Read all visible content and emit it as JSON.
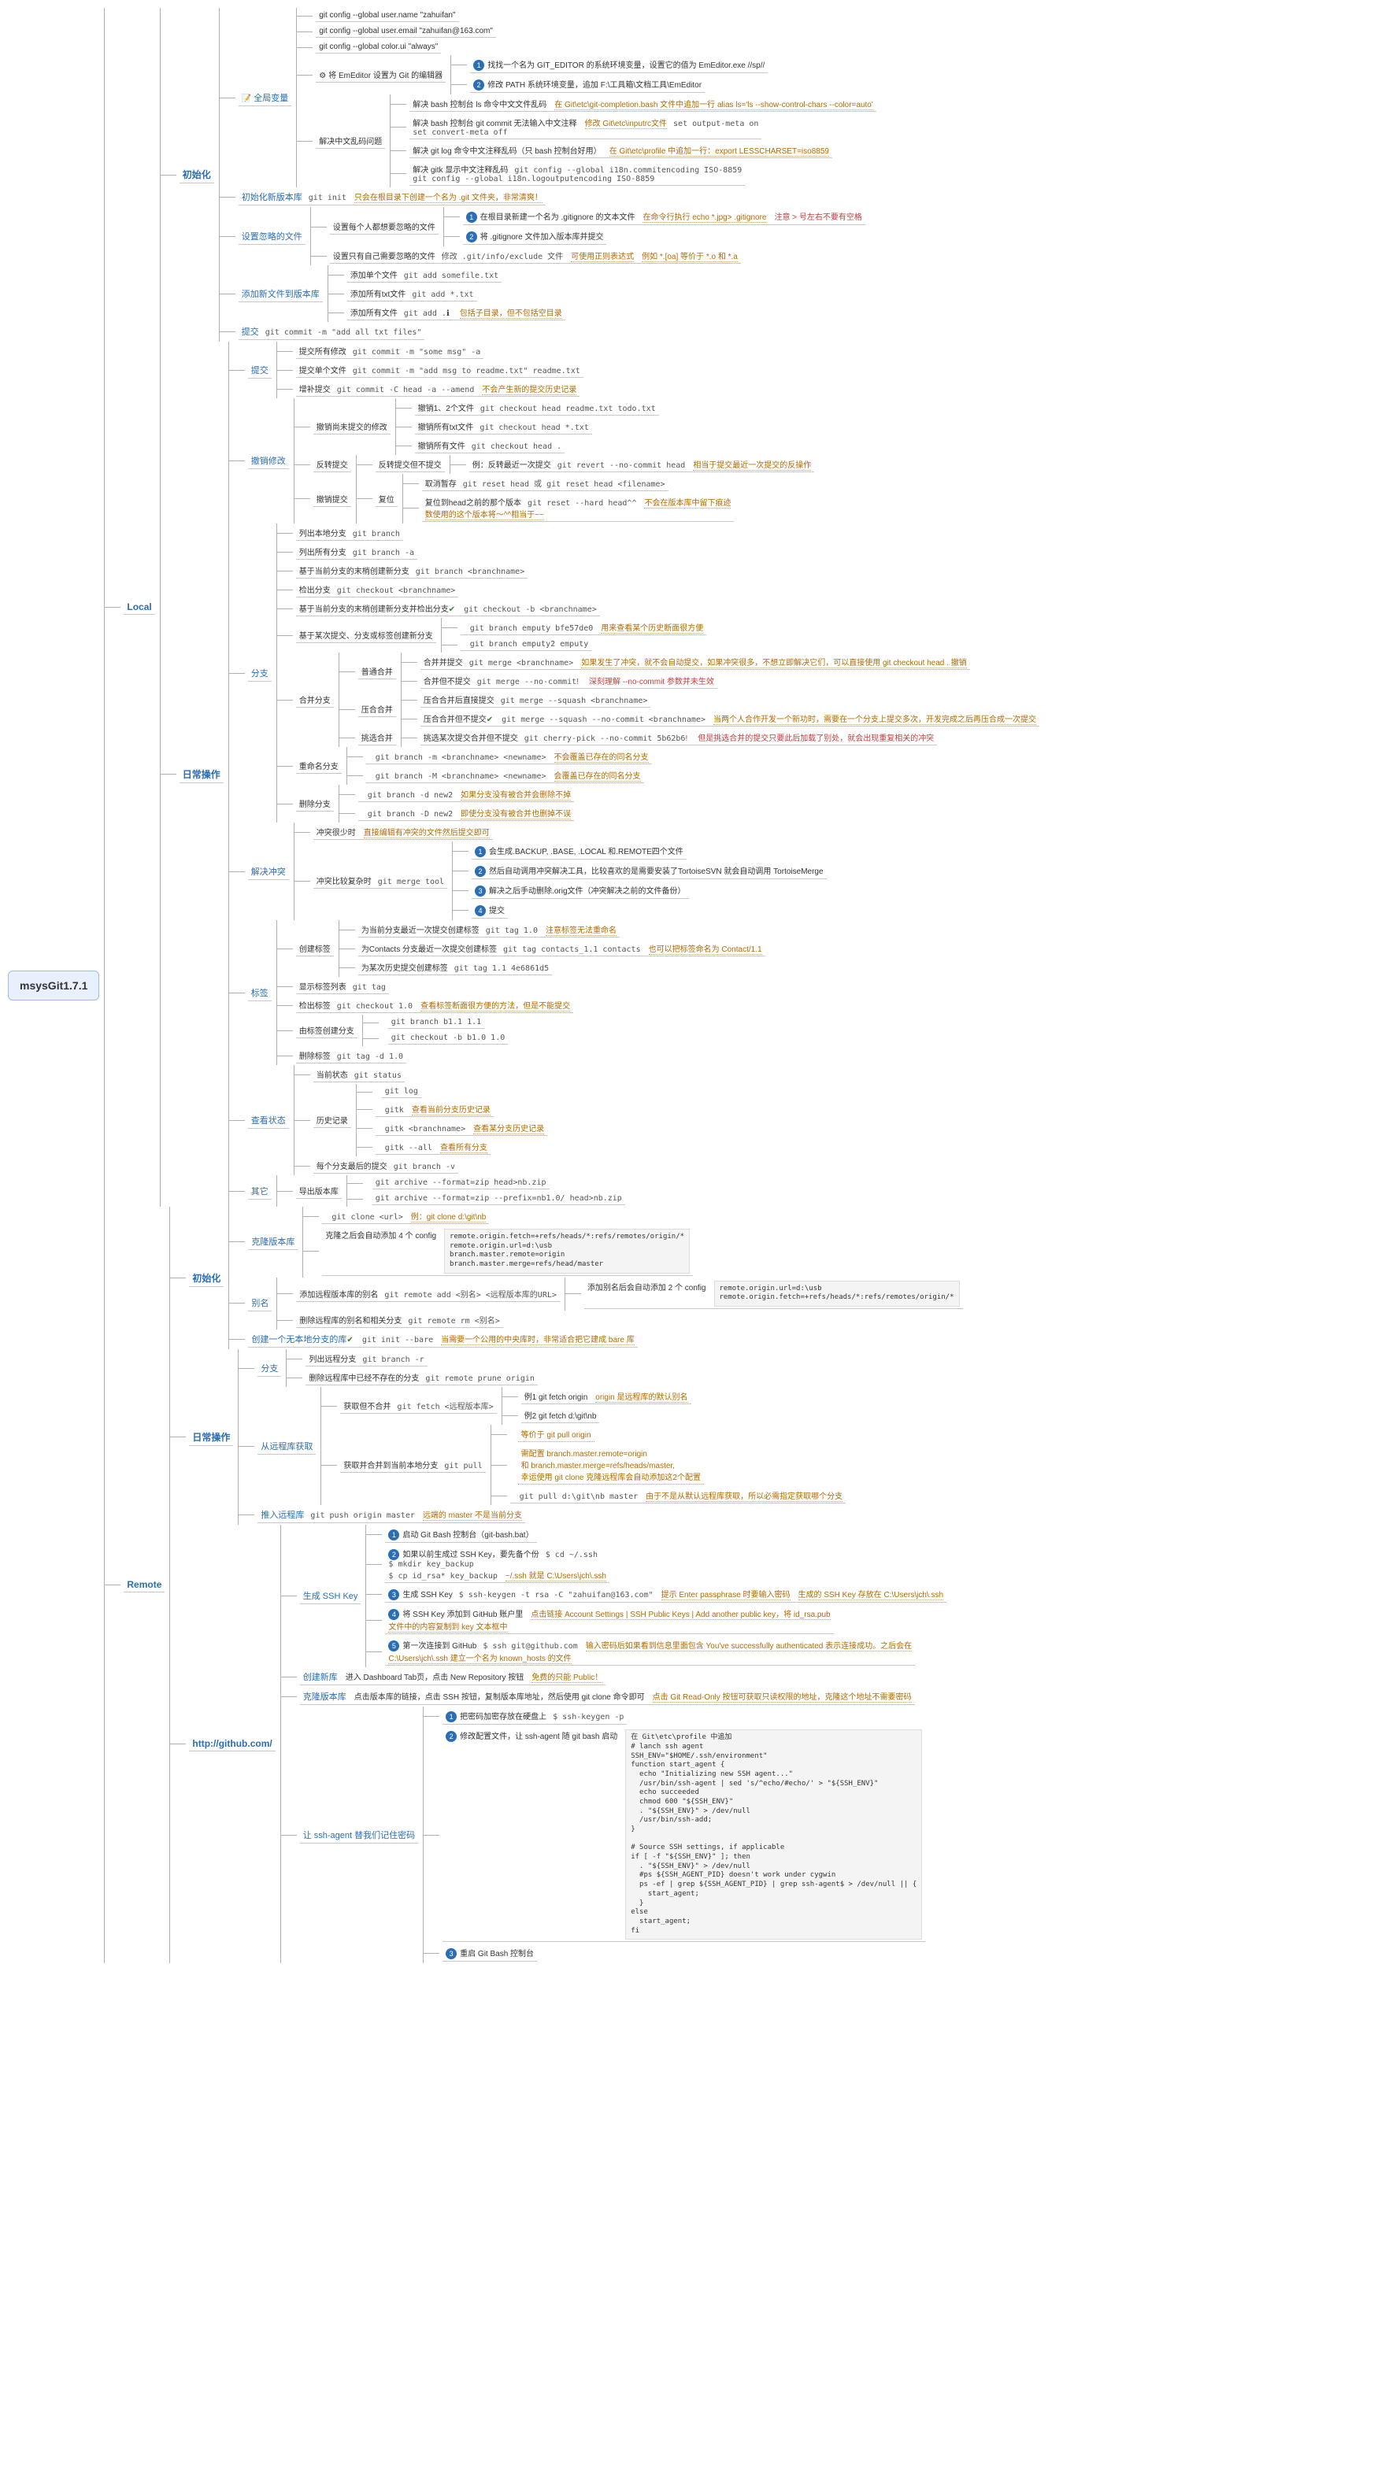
{
  "root": "msysGit1.7.1",
  "local": {
    "title": "Local",
    "init": {
      "title": "初始化",
      "global": {
        "title": "全局变量",
        "icon": "📝",
        "c1": "git config --global user.name \"zahuifan\"",
        "c2": "git config --global user.email \"zahuifan@163.com\"",
        "c3": "git config --global color.ui \"always\"",
        "editor": {
          "t": "将 EmEditor 设置为 Git 的编辑器",
          "b1": "找找一个名为 GIT_EDITOR 的系统环境变量，设置它的值为 EmEditor.exe //sp//",
          "b2": "修改 PATH 系统环境变量，追加 F:\\工具箱\\文档工具\\EmEditor"
        },
        "cn": {
          "t": "解决中文乱码问题",
          "l1": {
            "a": "解决 bash 控制台 ls 命令中文文件乱码",
            "b": "在 Git\\etc\\git-completion.bash 文件中追加一行 alias ls='ls --show-control-chars --color=auto'"
          },
          "l2": {
            "a": "解决 bash 控制台 git commit 无法输入中文注释",
            "b": "修改 Git\\etc\\inputrc文件",
            "c": "set output-meta on\nset convert-meta off"
          },
          "l3": {
            "a": "解决 git log 命令中文注释乱码（只 bash 控制台好用）",
            "b": "在 Git\\etc\\profile 中追加一行：export LESSCHARSET=iso8859"
          },
          "l4": {
            "a": "解决 gitk 显示中文注释乱码",
            "b": "git config --global i18n.commitencoding ISO-8859\ngit config --global i18n.logoutputencoding ISO-8859"
          }
        }
      },
      "newrepo": {
        "t": "初始化新版本库",
        "c": "git init",
        "n": "只会在根目录下创建一个名为 .git 文件夹，非常清爽！"
      },
      "ignore": {
        "t": "设置忽略的文件",
        "all": {
          "t": "设置每个人都想要忽略的文件",
          "b1": {
            "a": "在根目录新建一个名为 .gitignore 的文本文件",
            "b": "在命令行执行 echo *.jpg> .gitignore",
            "c": "注意 > 号左右不要有空格"
          },
          "b2": "将 .gitignore 文件加入版本库并提交"
        },
        "self": {
          "t": "设置只有自己需要忽略的文件",
          "a": "修改 .git/info/exclude 文件",
          "b": "可使用正则表达式",
          "c": "例如 *.[oa] 等价于 *.o 和 *.a"
        }
      },
      "add": {
        "t": "添加新文件到版本库",
        "a1": {
          "t": "添加单个文件",
          "c": "git add somefile.txt"
        },
        "a2": {
          "t": "添加所有txt文件",
          "c": "git add *.txt"
        },
        "a3": {
          "t": "添加所有文件",
          "c": "git add .",
          "n": "包括子目录，但不包括空目录"
        }
      },
      "commit": {
        "t": "提交",
        "c": "git commit -m \"add all txt files\""
      }
    },
    "daily": {
      "title": "日常操作",
      "commit": {
        "t": "提交",
        "a": {
          "t": "提交所有修改",
          "c": "git commit -m \"some msg\" -a"
        },
        "b": {
          "t": "提交单个文件",
          "c": "git commit -m \"add msg to readme.txt\" readme.txt"
        },
        "c": {
          "t": "增补提交",
          "c": "git commit -C head -a --amend",
          "n": "不会产生新的提交历史记录"
        }
      },
      "undo": {
        "t": "撤销修改",
        "uncommit": {
          "t": "撤销尚未提交的修改",
          "x": {
            "t": "撤销1、2个文件",
            "c": "git checkout head readme.txt todo.txt"
          },
          "y": {
            "t": "撤销所有txt文件",
            "c": "git checkout head *.txt"
          },
          "z": {
            "t": "撤销所有文件",
            "c": "git checkout head ."
          }
        },
        "revert": {
          "t": "反转提交",
          "sub": "反转提交但不提交",
          "a": {
            "t": "例：反转最近一次提交",
            "c": "git revert --no-commit head",
            "n": "相当于提交最近一次提交的反操作"
          }
        },
        "reset": {
          "t": "撤销提交",
          "sub": "复位",
          "a": {
            "t": "取消暂存",
            "c": "git reset head 或 git reset head <filename>"
          },
          "b": {
            "t": "复位到head之前的那个版本",
            "c": "git reset --hard head^^",
            "n": "不会在版本库中留下痕迹\n数使用的这个版本将～^^相当于~~"
          }
        }
      },
      "branch": {
        "t": "分支",
        "l1": {
          "t": "列出本地分支",
          "c": "git branch"
        },
        "l2": {
          "t": "列出所有分支",
          "c": "git branch -a"
        },
        "l3": {
          "t": "基于当前分支的末梢创建新分支",
          "c": "git branch <branchname>"
        },
        "l4": {
          "t": "检出分支",
          "c": "git checkout <branchname>"
        },
        "l5": {
          "t": "基于当前分支的末梢创建新分支并检出分支",
          "c": "git checkout -b <branchname>",
          "ico": "✔"
        },
        "l6": {
          "t": "基于某次提交、分支或标签创建新分支",
          "a": {
            "c": "git branch emputy bfe57de0",
            "n": "用来查看某个历史断面很方便"
          },
          "b": {
            "c": "git branch emputy2 emputy"
          }
        },
        "merge": {
          "t": "合并分支",
          "n": {
            "t": "普通合并",
            "a": {
              "t": "合并并提交",
              "c": "git merge <branchname>",
              "n": "如果发生了冲突，就不会自动提交，如果冲突很多，不想立即解决它们，可以直接使用 git checkout head . 撤销"
            },
            "b": {
              "t": "合并但不提交",
              "c": "git merge --no-commit",
              "n2": "深刻理解 --no-commit 参数并未生效"
            }
          },
          "s": {
            "t": "压合合并",
            "a": {
              "t": "压合合并后直接提交",
              "c": "git merge --squash <branchname>"
            },
            "b": {
              "t": "压合合并但不提交",
              "c": "git merge --squash --no-commit <branchname>",
              "ico": "✔",
              "n": "当两个人合作开发一个新功时，需要在一个分支上提交多次，开发完成之后再压合成一次提交"
            }
          },
          "p": {
            "t": "挑选合并",
            "a": {
              "t": "挑选某次提交合并但不提交",
              "c": "git cherry-pick --no-commit 5b62b6",
              "n2": "但是挑选合并的提交只要此后加载了别处，就会出现重复相关的冲突"
            }
          }
        },
        "rename": {
          "t": "重命名分支",
          "a": {
            "c": "git branch -m <branchname> <newname>",
            "n": "不会覆盖已存在的同名分支"
          },
          "b": {
            "c": "git branch -M <branchname> <newname>",
            "n": "会覆盖已存在的同名分支"
          }
        },
        "del": {
          "t": "删除分支",
          "a": {
            "c": "git branch -d new2",
            "n": "如果分支没有被合并会删除不掉"
          },
          "b": {
            "c": "git branch -D new2",
            "n": "即使分支没有被合并也删掉不误"
          }
        }
      },
      "conflict": {
        "t": "解决冲突",
        "a": {
          "t": "冲突很少时",
          "n": "直接编辑有冲突的文件然后提交即可"
        },
        "b": {
          "t": "冲突比较复杂时",
          "c": "git merge tool",
          "b1": "会生成.BACKUP, .BASE, .LOCAL 和.REMOTE四个文件",
          "b2": "然后自动调用冲突解决工具，比较喜欢的是需要安装了TortoiseSVN 就会自动调用 TortoiseMerge",
          "b3": "解决之后手动删除.orig文件（冲突解决之前的文件备份）",
          "b4": "提交"
        }
      },
      "tag": {
        "t": "标签",
        "create": {
          "t": "创建标签",
          "a": {
            "t": "为当前分支最近一次提交创建标签",
            "c": "git tag 1.0",
            "n": "注意标签无法重命名"
          },
          "b": {
            "t": "为Contacts 分支最近一次提交创建标签",
            "c": "git tag contacts_1.1 contacts",
            "n": "也可以把标签命名为 Contact/1.1"
          },
          "c": {
            "t": "为某次历史提交创建标签",
            "c": "git tag 1.1 4e6861d5"
          }
        },
        "list": {
          "t": "显示标签列表",
          "c": "git tag"
        },
        "co": {
          "t": "检出标签",
          "c": "git checkout 1.0",
          "n": "查看标签断面很方便的方法，但是不能提交"
        },
        "br": {
          "t": "由标签创建分支",
          "a": "git branch b1.1 1.1",
          "b": "git checkout -b b1.0 1.0"
        },
        "del": {
          "t": "删除标签",
          "c": "git tag -d 1.0"
        }
      },
      "status": {
        "t": "查看状态",
        "a": {
          "t": "当前状态",
          "c": "git status"
        },
        "b": {
          "t": "历史记录",
          "b1": {
            "c": "git log"
          },
          "b2": {
            "c": "gitk",
            "n": "查看当前分支历史记录"
          },
          "b3": {
            "c": "gitk <branchname>",
            "n": "查看某分支历史记录"
          },
          "b4": {
            "c": "gitk --all",
            "n": "查看所有分支"
          }
        },
        "c": {
          "t": "每个分支最后的提交",
          "c": "git branch -v"
        }
      },
      "other": {
        "t": "其它",
        "sub": "导出版本库",
        "a": "git archive --format=zip head>nb.zip",
        "b": "git archive --format=zip --prefix=nb1.0/ head>nb.zip"
      }
    }
  },
  "remote": {
    "title": "Remote",
    "init": {
      "title": "初始化",
      "clone": {
        "t": "克隆版本库",
        "a": {
          "c": "git clone <url>",
          "n": "例：git clone d:\\git\\nb"
        },
        "b": {
          "t": "克隆之后会自动添加 4 个 config",
          "code": "remote.origin.fetch=+refs/heads/*:refs/remotes/origin/*\nremote.origin.url=d:\\usb\nbranch.master.remote=origin\nbranch.master.merge=refs/head/master"
        }
      },
      "alias": {
        "t": "别名",
        "a": {
          "t": "添加远程版本库的别名",
          "c": "git remote add <别名> <远程版本库的URL>",
          "sub": {
            "t": "添加别名后会自动添加 2 个 config",
            "code": "remote.origin.url=d:\\usb\nremote.origin.fetch=+refs/heads/*:refs/remotes/origin/*"
          }
        },
        "b": {
          "t": "删除远程库的别名和相关分支",
          "c": "git remote rm <别名>"
        }
      },
      "bare": {
        "t": "创建一个无本地分支的库",
        "c": "git init --bare",
        "ico": "✔",
        "n": "当需要一个公用的中央库时，非常适合把它建成 bare 库"
      }
    },
    "daily": {
      "title": "日常操作",
      "branch": {
        "t": "分支",
        "a": {
          "t": "列出远程分支",
          "c": "git branch -r"
        },
        "b": {
          "t": "删除远程库中已经不存在的分支",
          "c": "git remote prune origin"
        }
      },
      "fetch": {
        "t": "从远程库获取",
        "a": {
          "t": "获取但不合并",
          "c": "git fetch <远程版本库>",
          "e1": {
            "t": "例1 git fetch origin",
            "n": "origin 是远程库的默认别名"
          },
          "e2": {
            "t": "例2 git fetch d:\\git\\nb"
          }
        },
        "b": {
          "t": "获取并合并到当前本地分支",
          "c": "git pull",
          "n1": "等价于 git pull origin",
          "n2": "需配置 branch.master.remote=origin\n和 branch.master.merge=refs/heads/master,\n幸运使用 git clone 克隆远程库会自动添加这2个配置",
          "n3": {
            "c": "git pull d:\\git\\nb master",
            "n": "由于不是从默认远程库获取，所以必需指定获取哪个分支"
          }
        }
      },
      "push": {
        "t": "推入远程库",
        "c": "git push origin master",
        "n": "远端的 master 不是当前分支"
      }
    },
    "github": {
      "title": "http://github.com/",
      "ssh": {
        "t": "生成 SSH Key",
        "s1": {
          "t": "启动 Git Bash 控制台（git-bash.bat）"
        },
        "s2": {
          "t": "如果以前生成过 SSH Key，要先备个份",
          "c": "$ cd ~/.ssh\n$ mkdir key_backup\n$ cp id_rsa* key_backup",
          "n": "~/.ssh 就是 C:\\Users\\jch\\.ssh"
        },
        "s3": {
          "t": "生成 SSH Key",
          "c": "$ ssh-keygen -t rsa -C \"zahuifan@163.com\"",
          "n1": "提示 Enter passphrase 时要输入密码",
          "n2": "生成的 SSH Key 存放在 C:\\Users\\jch\\.ssh"
        },
        "s4": {
          "t": "将 SSH Key 添加到 GitHub 账户里",
          "n": "点击链接 Account Settings | SSH Public Keys | Add another public key，将 id_rsa.pub\n文件中的内容复制到 key 文本框中"
        },
        "s5": {
          "t": "第一次连接到 GitHub",
          "c": "$ ssh git@github.com",
          "n": "输入密码后如果看到信息里面包含 You've successfully authenticated 表示连接成功。之后会在\nC:\\Users\\jch\\.ssh 建立一个名为 known_hosts 的文件"
        }
      },
      "new": {
        "t": "创建新库",
        "a": "进入 Dashboard Tab页，点击 New Repository 按钮",
        "n": "免费的只能 Public！"
      },
      "clone": {
        "t": "克隆版本库",
        "a": "点击版本库的链接，点击 SSH 按钮，复制版本库地址，然后使用 git clone 命令即可",
        "n": "点击 Git Read-Only 按钮可获取只读权限的地址，克隆这个地址不需要密码"
      },
      "agent": {
        "t": "让 ssh-agent 替我们记住密码",
        "s1": {
          "t": "把密码加密存放在硬盘上",
          "c": "$ ssh-keygen -p"
        },
        "s2": {
          "t": "修改配置文件，让 ssh-agent 随 git bash 启动",
          "code": "在 Git\\etc\\profile 中追加\n# lanch ssh agent\nSSH_ENV=\"$HOME/.ssh/environment\"\nfunction start_agent {\n  echo \"Initializing new SSH agent...\"\n  /usr/bin/ssh-agent | sed 's/^echo/#echo/' > \"${SSH_ENV}\"\n  echo succeeded\n  chmod 600 \"${SSH_ENV}\"\n  . \"${SSH_ENV}\" > /dev/null\n  /usr/bin/ssh-add;\n}\n\n# Source SSH settings, if applicable\nif [ -f \"${SSH_ENV}\" ]; then\n  . \"${SSH_ENV}\" > /dev/null\n  #ps ${SSH_AGENT_PID} doesn't work under cygwin\n  ps -ef | grep ${SSH_AGENT_PID} | grep ssh-agent$ > /dev/null || {\n    start_agent;\n  }\nelse\n  start_agent;\nfi"
        },
        "s3": {
          "t": "重启 Git Bash 控制台"
        }
      }
    }
  }
}
